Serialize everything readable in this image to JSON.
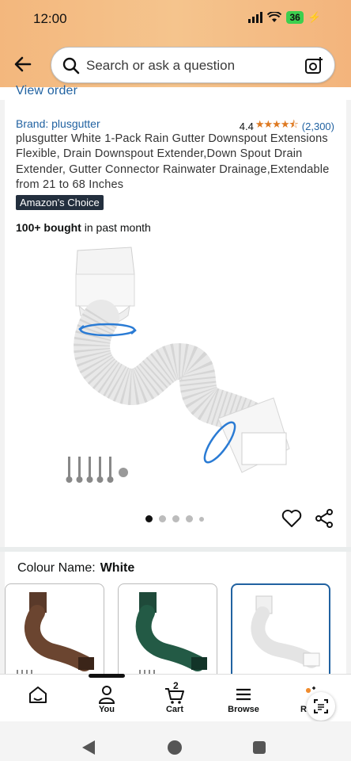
{
  "status": {
    "time": "12:00",
    "battery": "36"
  },
  "search": {
    "placeholder": "Search or ask a question"
  },
  "view_order": "View order",
  "product": {
    "brand": "Brand: plusgutter",
    "rating": "4.4",
    "stars_value": 4.4,
    "reviews": "(2,300)",
    "title": "plusgutter White 1-Pack Rain Gutter Downspout Extensions Flexible, Drain Downspout Extender,Down Spout Drain Extender, Gutter Connector Rainwater Drainage,Extendable from 21 to 68 Inches",
    "badge": "Amazon's Choice",
    "bought_strong": "100+ bought",
    "bought_rest": " in past month",
    "image_count": 5,
    "active_image": 1
  },
  "colour": {
    "label": "Colour Name:",
    "value": "White",
    "swatches": [
      "Brown",
      "Green",
      "White"
    ],
    "selected": "White"
  },
  "nav": {
    "items": [
      {
        "label": "",
        "icon": "home-icon"
      },
      {
        "label": "You",
        "icon": "person-icon"
      },
      {
        "label": "Cart",
        "icon": "cart-icon",
        "badge": "2"
      },
      {
        "label": "Browse",
        "icon": "menu-icon"
      },
      {
        "label": "R",
        "icon": "rufus-icon"
      }
    ]
  },
  "colors": {
    "header": "#f4bd86",
    "link": "#2162a1",
    "star": "#de7921",
    "badge_bg": "#232f3e",
    "selected_border": "#2162a1"
  }
}
